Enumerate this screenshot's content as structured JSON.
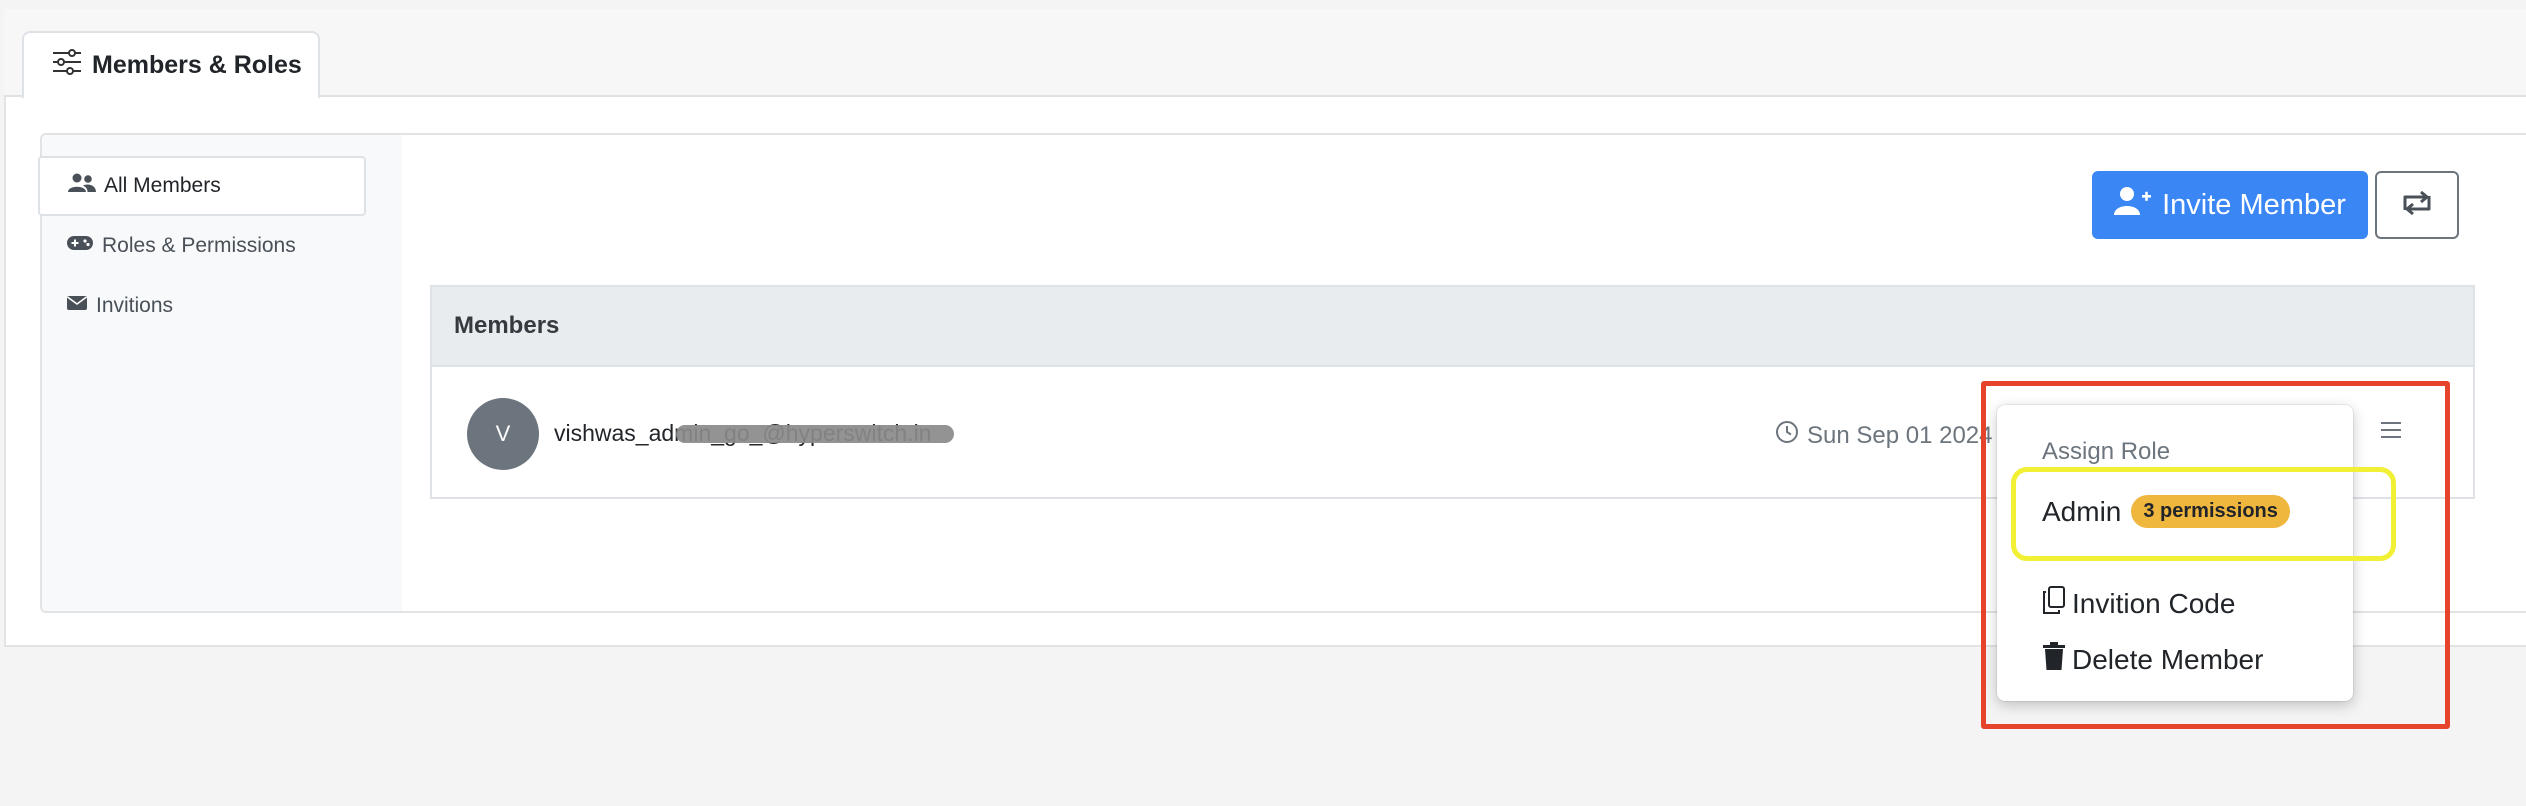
{
  "tab": {
    "label": "Members & Roles",
    "icon": "sliders-icon"
  },
  "sidebar": {
    "items": [
      {
        "label": "All Members",
        "icon": "users-icon",
        "active": true
      },
      {
        "label": "Roles & Permissions",
        "icon": "gamepad-icon",
        "active": false
      },
      {
        "label": "Invitions",
        "icon": "envelope-icon",
        "active": false
      }
    ]
  },
  "toolbar": {
    "invite_label": "Invite Member",
    "invite_icon": "user-plus-icon",
    "refresh_icon": "refresh-icon"
  },
  "members": {
    "header": "Members",
    "rows": [
      {
        "avatar_initial": "V",
        "email": "vishwas_admin_go_@hyperswitch.in",
        "date": "Sun Sep 01 2024"
      }
    ]
  },
  "dropdown": {
    "header": "Assign Role",
    "role": {
      "label": "Admin",
      "badge": "3 permissions"
    },
    "items": [
      {
        "label": "Invition Code",
        "icon": "copy-icon"
      },
      {
        "label": "Delete Member",
        "icon": "trash-icon"
      }
    ]
  },
  "colors": {
    "primary": "#3a86f5",
    "badge": "#f0b73e",
    "annotation_red": "#e5442b",
    "annotation_yellow": "#f2f035"
  }
}
